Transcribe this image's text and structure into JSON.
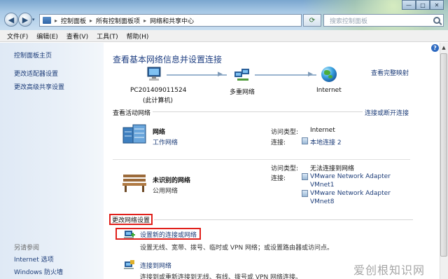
{
  "window": {
    "back_glyph": "◀",
    "forward_glyph": "▶",
    "dropdown_glyph": "▾",
    "refresh_glyph": "⟳",
    "controls": [
      "—",
      "□",
      "✕"
    ]
  },
  "address": {
    "separator": "▸",
    "crumbs": [
      "控制面板",
      "所有控制面板项",
      "网络和共享中心"
    ]
  },
  "search": {
    "placeholder": "搜索控制面板"
  },
  "menu": [
    "文件(F)",
    "编辑(E)",
    "查看(V)",
    "工具(T)",
    "帮助(H)"
  ],
  "sidebar": {
    "links": [
      "控制面板主页",
      "更改适配器设置",
      "更改高级共享设置"
    ],
    "see_also": "另请参阅",
    "see_also_links": [
      "Internet 选项",
      "Windows 防火墙"
    ]
  },
  "main": {
    "title": "查看基本网络信息并设置连接",
    "view_full_map": "查看完整映射",
    "help": "?",
    "map": {
      "computer_name": "PC201409011524",
      "computer_sub": "(此计算机)",
      "middle": "多重网络",
      "internet": "Internet"
    },
    "active_header": "查看活动网络",
    "connect_disconnect": "连接或断开连接",
    "networks": [
      {
        "name": "网络",
        "type": "工作网络",
        "access_label": "访问类型:",
        "access_value": "Internet",
        "conn_label": "连接:",
        "connections": [
          "本地连接 2"
        ]
      },
      {
        "name": "未识别的网络",
        "type": "公用网络",
        "access_label": "访问类型:",
        "access_value": "无法连接到网络",
        "conn_label": "连接:",
        "connections": [
          "VMware Network Adapter",
          "VMnet1",
          "VMware Network Adapter",
          "VMnet8"
        ]
      }
    ],
    "change_settings": "更改网络设置",
    "tasks": [
      {
        "link": "设置新的连接或网络",
        "desc": "设置无线、宽带、拨号、临时或 VPN 网络；或设置路由器或访问点。"
      },
      {
        "link": "连接到网络",
        "desc": "连接到或重新连接到无线、有线、拨号或 VPN 网络连接。"
      }
    ]
  },
  "scroll_up_glyph": "▲",
  "watermark": "爱创根知识网",
  "colors": {
    "link": "#1c3c78",
    "title": "#1f3f82",
    "highlight_border": "#e0201b"
  }
}
